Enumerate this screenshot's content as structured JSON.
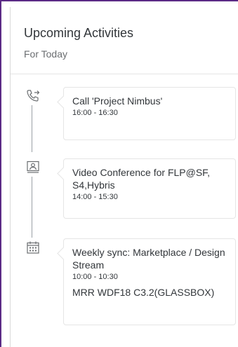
{
  "header": {
    "title": "Upcoming Activities",
    "subtitle": "For Today"
  },
  "activities": [
    {
      "icon": "outgoing-call-icon",
      "title": "Call 'Project Nimbus'",
      "time": "16:00 - 16:30",
      "extra": ""
    },
    {
      "icon": "video-conference-icon",
      "title": "Video Conference for FLP@SF, S4,Hybris",
      "time": "14:00 - 15:30",
      "extra": ""
    },
    {
      "icon": "calendar-icon",
      "title": "Weekly sync: Marketplace / Design Stream",
      "time": "10:00 - 10:30",
      "extra": "MRR WDF18 C3.2(GLASSBOX)"
    }
  ],
  "colors": {
    "accent_frame": "#5b2a86",
    "text": "#32363a",
    "muted": "#6a6d70",
    "border": "#e5e5e5"
  }
}
